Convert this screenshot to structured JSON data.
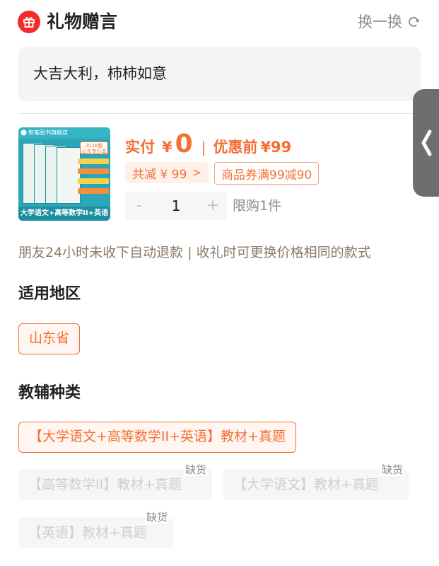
{
  "header": {
    "title": "礼物赠言",
    "refresh_label": "换一换"
  },
  "message": {
    "text": "大吉大利，柿柿如意"
  },
  "product": {
    "image": {
      "brand_text": "智笔图书旗舰店",
      "year_tag": "2026版\n山东专升本",
      "bottom_text": "大学语文+高等数学II+英语"
    },
    "price_label": "实付",
    "price_symbol": "¥",
    "price_value": "0",
    "price_separator": "|",
    "original_label": "优惠前",
    "original_value": "¥99",
    "discount_text": "共减 ¥ 99",
    "discount_chevron": ">",
    "coupon_text": "商品券满99减90",
    "quantity": {
      "minus": "-",
      "value": "1",
      "plus": "+"
    },
    "limit_text": "限购1件"
  },
  "notice": "朋友24小时未收下自动退款 | 收礼时可更换价格相同的款式",
  "region_section": {
    "title": "适用地区",
    "options": [
      {
        "label": "山东省",
        "state": "selected"
      }
    ]
  },
  "type_section": {
    "title": "教辅种类",
    "options": [
      {
        "label": "【大学语文+高等数学II+英语】教材+真题",
        "state": "selected",
        "badge": ""
      },
      {
        "label": "【高等数学II】教材+真题",
        "state": "disabled",
        "badge": "缺货"
      },
      {
        "label": "【大学语文】教材+真题",
        "state": "disabled",
        "badge": "缺货"
      },
      {
        "label": "【英语】教材+真题",
        "state": "disabled",
        "badge": "缺货"
      }
    ]
  },
  "colors": {
    "accent": "#f36f34",
    "gift_icon": "#f22c2c",
    "disabled_text": "#cfcfcf",
    "side_tab": "#6e6e6e"
  },
  "icons": {
    "gift": "gift-icon",
    "refresh": "refresh-icon",
    "side_tab": "chevron-left-icon"
  }
}
